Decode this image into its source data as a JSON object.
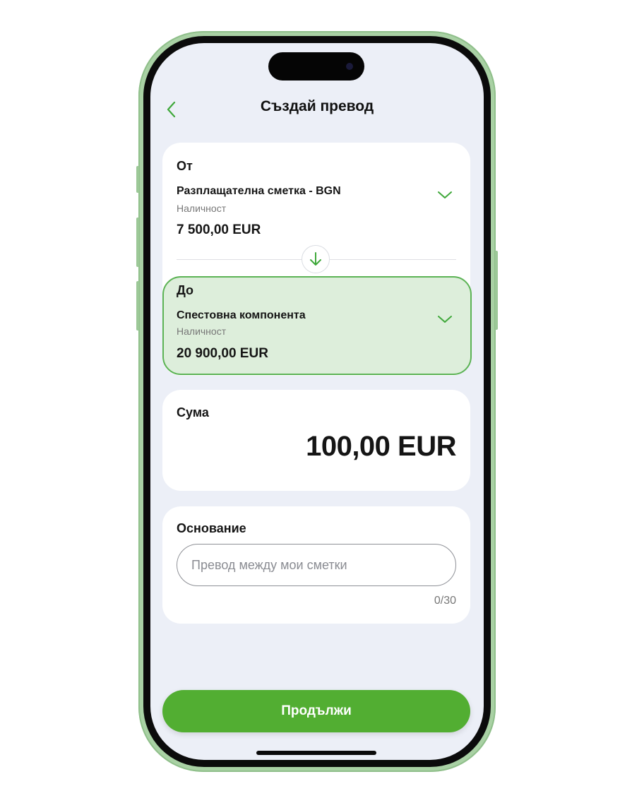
{
  "header": {
    "title": "Създай превод",
    "back_icon": "chevron-left-icon"
  },
  "from": {
    "label": "От",
    "account_name": "Разплащателна сметка - BGN",
    "balance_label": "Наличност",
    "balance_value": "7 500,00 EUR"
  },
  "swap_icon": "arrow-down-icon",
  "to": {
    "label": "До",
    "account_name": "Спестовна компонента",
    "balance_label": "Наличност",
    "balance_value": "20 900,00 EUR",
    "selected": true
  },
  "amount": {
    "label": "Сума",
    "value": "100,00 EUR"
  },
  "reason": {
    "label": "Основание",
    "placeholder": "Превод между мои сметки",
    "value": "",
    "counter": "0/30"
  },
  "continue_label": "Продължи",
  "colors": {
    "accent": "#52ae32",
    "selected_bg": "#ddeedb",
    "selected_border": "#5cb355",
    "screen_bg": "#eceff7",
    "phone_frame": "#a9d1a4"
  }
}
